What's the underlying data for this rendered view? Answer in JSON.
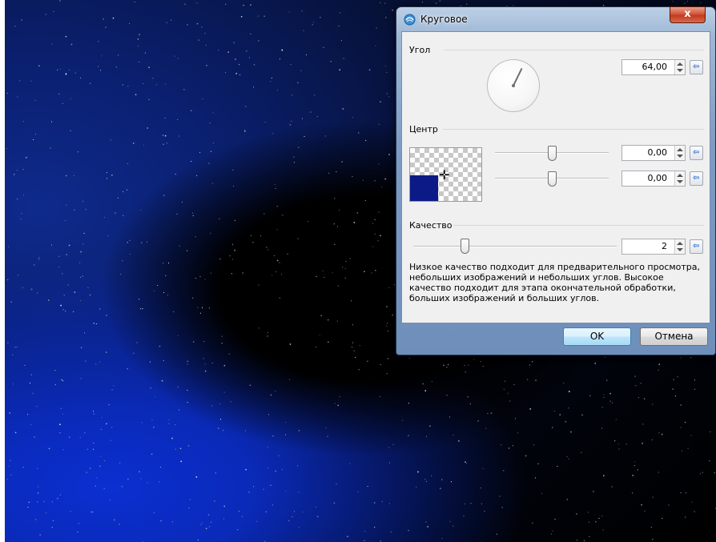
{
  "dialog": {
    "title": "Круговое",
    "close_glyph": "x"
  },
  "angle": {
    "label": "Угол",
    "value": "64,00",
    "dial_degrees": 64
  },
  "center": {
    "label": "Центр",
    "x_value": "0,00",
    "y_value": "0,00",
    "x_slider_fraction": 0.5,
    "y_slider_fraction": 0.5
  },
  "quality": {
    "label": "Качество",
    "value": "2",
    "slider_fraction": 0.25,
    "description": "Низкое качество подходит для предварительного просмотра, небольших изображений и небольших углов. Высокое качество подходит для этапа окончательной обработки, больших изображений и больших углов."
  },
  "buttons": {
    "ok": "OK",
    "cancel": "Отмена"
  },
  "colors": {
    "preview_blue": "#0c1a87",
    "close_red": "#c23a1f",
    "reset_arrow_blue": "#2a6fd0"
  },
  "icons": {
    "app": "blur-effect-icon",
    "reset": "reset-arrow-icon",
    "crosshair": "crosshair-icon"
  }
}
